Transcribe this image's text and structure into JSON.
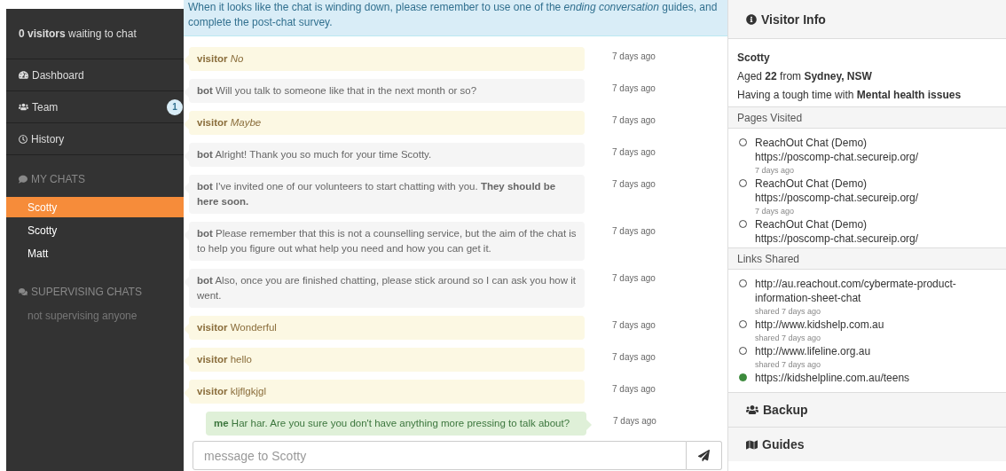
{
  "sidebar": {
    "waiting": "**0 visitors** waiting to chat",
    "nav": [
      {
        "kind": "dashboard",
        "label": "Dashboard"
      },
      {
        "kind": "team",
        "label": "Team",
        "badge": "1"
      },
      {
        "kind": "history",
        "label": "History"
      }
    ],
    "my_chats": {
      "title": "MY CHATS",
      "items": [
        {
          "label": "Scotty",
          "selected": true
        },
        {
          "label": "Scotty",
          "selected": false
        },
        {
          "label": "Matt",
          "selected": false
        }
      ]
    },
    "supervising": {
      "title": "SUPERVISING CHATS",
      "empty": "not supervising anyone"
    }
  },
  "chat": {
    "notice": "When it looks like the chat is winding down, please remember to use one of the *ending conversation* guides, and complete the post-chat survey.",
    "messages": [
      {
        "kind": "visitor",
        "text": "**visitor** *No*",
        "time": "7 days ago"
      },
      {
        "kind": "bot",
        "text": "**bot** Will you talk to someone like that in the next month or so?",
        "time": "7 days ago"
      },
      {
        "kind": "visitor",
        "text": "**visitor** *Maybe*",
        "time": "7 days ago"
      },
      {
        "kind": "bot",
        "text": "**bot** Alright! Thank you so much for your time Scotty.",
        "time": "7 days ago"
      },
      {
        "kind": "bot",
        "text": "**bot** I've invited one of our volunteers to start chatting with you. **They should be here soon.**",
        "time": "7 days ago"
      },
      {
        "kind": "bot",
        "text": "**bot** Please remember that this is not a counselling service, but the aim of the chat is to help you figure out what help you need and how you can get it.",
        "time": "7 days ago"
      },
      {
        "kind": "bot",
        "text": "**bot** Also, once you are finished chatting, please stick around so I can ask you how it went.",
        "time": "7 days ago"
      },
      {
        "kind": "visitor",
        "text": "**visitor** Wonderful",
        "time": "7 days ago"
      },
      {
        "kind": "visitor",
        "text": "**visitor** hello",
        "time": "7 days ago"
      },
      {
        "kind": "visitor",
        "text": "**visitor** kljflgkjgl",
        "time": "7 days ago"
      },
      {
        "kind": "me",
        "text": "**me** Har har. Are you sure you don't have anything more pressing to talk about?",
        "time": "7 days ago"
      }
    ],
    "input": {
      "placeholder": "message to Scotty"
    }
  },
  "visitor_info": {
    "title": "Visitor Info",
    "name": "Scotty",
    "details": [
      "Aged **22** from **Sydney, NSW**",
      "Having a tough time with **Mental health issues**"
    ],
    "pages_visited": {
      "title": "Pages Visited",
      "items": [
        {
          "title": "ReachOut Chat (Demo)",
          "url": "https://poscomp-chat.secureip.org/",
          "time": "7 days ago"
        },
        {
          "title": "ReachOut Chat (Demo)",
          "url": "https://poscomp-chat.secureip.org/",
          "time": "7 days ago"
        },
        {
          "title": "ReachOut Chat (Demo)",
          "url": "https://poscomp-chat.secureip.org/"
        }
      ]
    },
    "links_shared": {
      "title": "Links Shared",
      "items": [
        {
          "url": "http://au.reachout.com/cybermate-product-information-sheet-chat",
          "time": "shared 7 days ago",
          "active": false
        },
        {
          "url": "http://www.kidshelp.com.au",
          "time": "shared 7 days ago",
          "active": false
        },
        {
          "url": "http://www.lifeline.org.au",
          "time": "shared 7 days ago",
          "active": false
        },
        {
          "url": "https://kidshelpline.com.au/teens",
          "active": true
        }
      ]
    }
  },
  "panels": [
    {
      "kind": "backup",
      "title": "Backup"
    },
    {
      "kind": "guides",
      "title": "Guides"
    }
  ]
}
